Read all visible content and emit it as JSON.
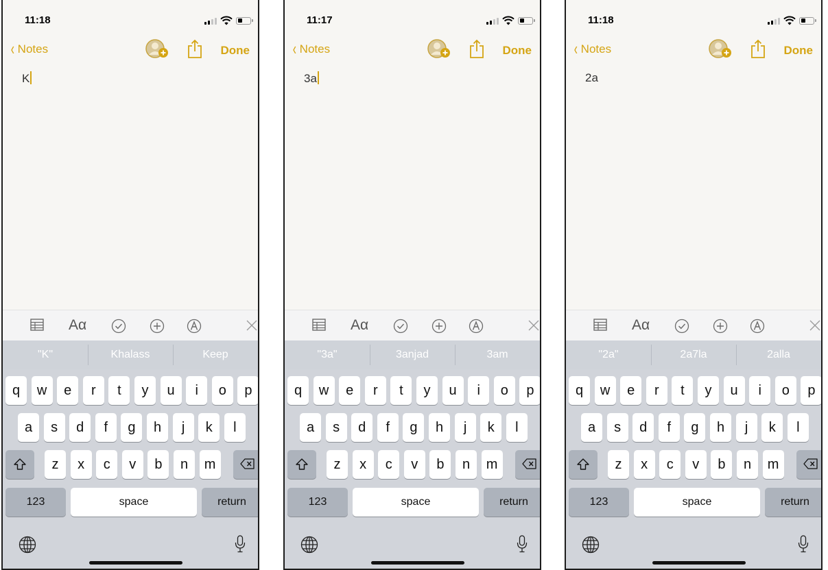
{
  "screens": [
    {
      "status": {
        "time": "11:18"
      },
      "nav": {
        "back_label": "Notes",
        "done_label": "Done"
      },
      "note": {
        "text": "K",
        "cursor_visible": true
      },
      "toolbar": {
        "text_format_label": "Aα"
      },
      "suggestions": [
        "\"K\"",
        "Khalass",
        "Keep"
      ],
      "keyboard": {
        "row1": [
          "q",
          "w",
          "e",
          "r",
          "t",
          "y",
          "u",
          "i",
          "o",
          "p"
        ],
        "row2": [
          "a",
          "s",
          "d",
          "f",
          "g",
          "h",
          "j",
          "k",
          "l"
        ],
        "row3": [
          "z",
          "x",
          "c",
          "v",
          "b",
          "n",
          "m"
        ],
        "numbers_label": "123",
        "space_label": "space",
        "return_label": "return"
      }
    },
    {
      "status": {
        "time": "11:17"
      },
      "nav": {
        "back_label": "Notes",
        "done_label": "Done"
      },
      "note": {
        "text": "3a",
        "cursor_visible": true
      },
      "toolbar": {
        "text_format_label": "Aα"
      },
      "suggestions": [
        "\"3a\"",
        "3anjad",
        "3am"
      ],
      "keyboard": {
        "row1": [
          "q",
          "w",
          "e",
          "r",
          "t",
          "y",
          "u",
          "i",
          "o",
          "p"
        ],
        "row2": [
          "a",
          "s",
          "d",
          "f",
          "g",
          "h",
          "j",
          "k",
          "l"
        ],
        "row3": [
          "z",
          "x",
          "c",
          "v",
          "b",
          "n",
          "m"
        ],
        "numbers_label": "123",
        "space_label": "space",
        "return_label": "return"
      }
    },
    {
      "status": {
        "time": "11:18"
      },
      "nav": {
        "back_label": "Notes",
        "done_label": "Done"
      },
      "note": {
        "text": "2a",
        "cursor_visible": false
      },
      "toolbar": {
        "text_format_label": "Aα"
      },
      "suggestions": [
        "\"2a\"",
        "2a7la",
        "2alla"
      ],
      "keyboard": {
        "row1": [
          "q",
          "w",
          "e",
          "r",
          "t",
          "y",
          "u",
          "i",
          "o",
          "p"
        ],
        "row2": [
          "a",
          "s",
          "d",
          "f",
          "g",
          "h",
          "j",
          "k",
          "l"
        ],
        "row3": [
          "z",
          "x",
          "c",
          "v",
          "b",
          "n",
          "m"
        ],
        "numbers_label": "123",
        "space_label": "space",
        "return_label": "return"
      }
    }
  ],
  "colors": {
    "accent": "#d5a514",
    "keyboard_bg": "#d1d4da",
    "predictive_bg": "#cfd3d9",
    "dark_key": "#adb3bc"
  },
  "icons": [
    "signal-icon",
    "wifi-icon",
    "battery-icon",
    "add-person-icon",
    "share-icon",
    "table-icon",
    "checklist-icon",
    "insert-icon",
    "markup-icon",
    "close-keyboard-icon",
    "shift-icon",
    "delete-icon",
    "globe-icon",
    "mic-icon"
  ]
}
